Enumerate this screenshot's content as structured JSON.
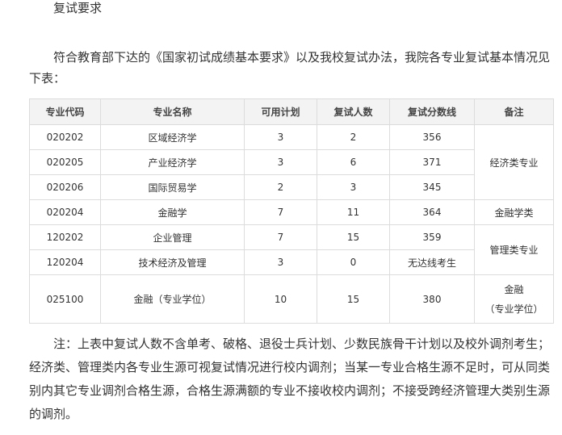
{
  "heading": "复试要求",
  "intro": "符合教育部下达的《国家初试成绩基本要求》以及我校复试办法，我院各专业复试基本情况见下表：",
  "table": {
    "headers": [
      "专业代码",
      "专业名称",
      "可用计划",
      "复试人数",
      "复试分数线",
      "备注"
    ],
    "rows": [
      {
        "code": "020202",
        "name": "区域经济学",
        "plan": "3",
        "count": "2",
        "score": "356"
      },
      {
        "code": "020205",
        "name": "产业经济学",
        "plan": "3",
        "count": "6",
        "score": "371"
      },
      {
        "code": "020206",
        "name": "国际贸易学",
        "plan": "2",
        "count": "3",
        "score": "345"
      },
      {
        "code": "020204",
        "name": "金融学",
        "plan": "7",
        "count": "11",
        "score": "364"
      },
      {
        "code": "120202",
        "name": "企业管理",
        "plan": "7",
        "count": "15",
        "score": "359"
      },
      {
        "code": "120204",
        "name": "技术经济及管理",
        "plan": "3",
        "count": "0",
        "score": "无达线考生"
      },
      {
        "code": "025100",
        "name": "金融（专业学位）",
        "plan": "10",
        "count": "15",
        "score": "380"
      }
    ],
    "remarks": {
      "economics": "经济类专业",
      "finance": "金融学类",
      "management": "管理类专业",
      "professional_line1": "金融",
      "professional_line2": "（专业学位）"
    }
  },
  "note": "注：上表中复试人数不含单考、破格、退役士兵计划、少数民族骨干计划以及校外调剂考生；经济类、管理类内各专业生源可视复试情况进行校内调剂；当某一专业合格生源不足时，可从同类别内其它专业调剂合格生源，合格生源满额的专业不接收校内调剂；不接受跨经济管理大类别生源的调剂。"
}
